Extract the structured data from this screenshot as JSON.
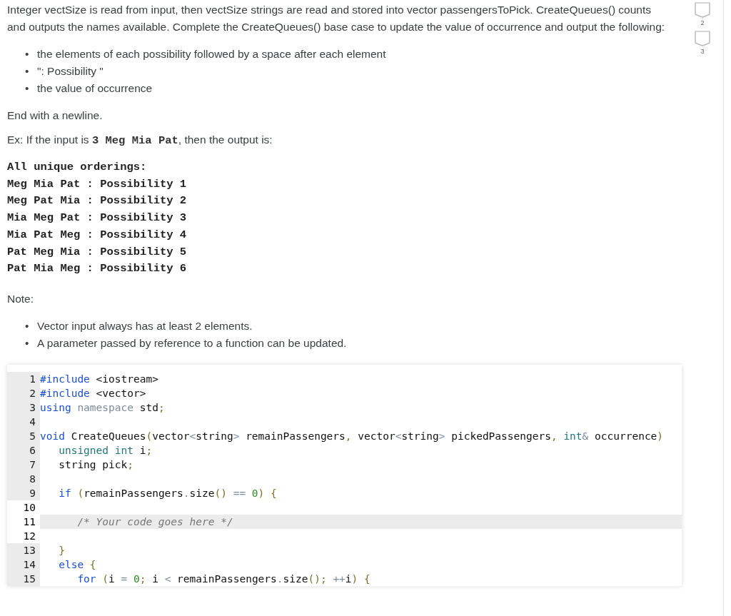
{
  "intro": "Integer vectSize is read from input, then vectSize strings are read and stored into vector passengersToPick. CreateQueues() counts and outputs the names available. Complete the CreateQueues() base case to update the value of occurrence and output the following:",
  "bullets": [
    {
      "marker": "•",
      "text": "the elements of each possibility followed by a space after each element"
    },
    {
      "marker": "•",
      "text": "\": Possibility \""
    },
    {
      "marker": "•",
      "text": "the value of occurrence"
    }
  ],
  "ending": "End with a newline.",
  "example": {
    "before": "Ex: If the input is ",
    "code": "3 Meg Mia Pat",
    "after": ", then the output is:"
  },
  "output_lines": [
    "All unique orderings:",
    "Meg Mia Pat : Possibility 1",
    "Meg Pat Mia : Possibility 2",
    "Mia Meg Pat : Possibility 3",
    "Mia Pat Meg : Possibility 4",
    "Pat Meg Mia : Possibility 5",
    "Pat Mia Meg : Possibility 6"
  ],
  "note_label": "Note:",
  "notes": [
    {
      "marker": "•",
      "text": "Vector input always has at least 2 elements."
    },
    {
      "marker": "•",
      "text": "A parameter passed by reference to a function can be updated."
    }
  ],
  "code_lines": [
    {
      "number": "1",
      "editable": false,
      "active": false,
      "tokens": [
        {
          "kind": "kw",
          "text": "#include"
        },
        {
          "kind": "plain",
          "text": " <iostream>"
        }
      ]
    },
    {
      "number": "2",
      "editable": false,
      "active": false,
      "tokens": [
        {
          "kind": "kw",
          "text": "#include"
        },
        {
          "kind": "plain",
          "text": " <vector>"
        }
      ]
    },
    {
      "number": "3",
      "editable": false,
      "active": false,
      "tokens": [
        {
          "kind": "kw",
          "text": "using"
        },
        {
          "kind": "ns",
          "text": " namespace"
        },
        {
          "kind": "plain",
          "text": " std"
        },
        {
          "kind": "punct",
          "text": ";"
        }
      ]
    },
    {
      "number": "4",
      "editable": false,
      "active": false
    },
    {
      "number": "5",
      "editable": false,
      "active": false,
      "tokens": [
        {
          "kind": "kw",
          "text": "void"
        },
        {
          "kind": "plain",
          "text": " CreateQueues"
        },
        {
          "kind": "punct",
          "text": "("
        },
        {
          "kind": "plain",
          "text": "vector"
        },
        {
          "kind": "ns",
          "text": "<"
        },
        {
          "kind": "plain",
          "text": "string"
        },
        {
          "kind": "ns",
          "text": ">"
        },
        {
          "kind": "plain",
          "text": " remainPassengers"
        },
        {
          "kind": "punct",
          "text": ","
        },
        {
          "kind": "plain",
          "text": " vector"
        },
        {
          "kind": "ns",
          "text": "<"
        },
        {
          "kind": "plain",
          "text": "string"
        },
        {
          "kind": "ns",
          "text": ">"
        },
        {
          "kind": "plain",
          "text": " pickedPassengers"
        },
        {
          "kind": "punct",
          "text": ","
        },
        {
          "kind": "type",
          "text": " int"
        },
        {
          "kind": "ns",
          "text": "&"
        },
        {
          "kind": "plain",
          "text": " occurrence"
        },
        {
          "kind": "punct",
          "text": ")"
        }
      ]
    },
    {
      "number": "6",
      "editable": false,
      "active": false,
      "tokens": [
        {
          "kind": "type",
          "text": "   unsigned int"
        },
        {
          "kind": "plain",
          "text": " i"
        },
        {
          "kind": "punct",
          "text": ";"
        }
      ]
    },
    {
      "number": "7",
      "editable": false,
      "active": false,
      "tokens": [
        {
          "kind": "plain",
          "text": "   string pick"
        },
        {
          "kind": "punct",
          "text": ";"
        }
      ]
    },
    {
      "number": "8",
      "editable": false,
      "active": false
    },
    {
      "number": "9",
      "editable": false,
      "active": false,
      "tokens": [
        {
          "kind": "kw",
          "text": "   if"
        },
        {
          "kind": "punct",
          "text": " ("
        },
        {
          "kind": "plain",
          "text": "remainPassengers"
        },
        {
          "kind": "ns",
          "text": "."
        },
        {
          "kind": "plain",
          "text": "size"
        },
        {
          "kind": "punct",
          "text": "()"
        },
        {
          "kind": "ns",
          "text": " =="
        },
        {
          "kind": "num",
          "text": " 0"
        },
        {
          "kind": "punct",
          "text": ") {"
        }
      ]
    },
    {
      "number": "10",
      "editable": true,
      "active": false
    },
    {
      "number": "11",
      "editable": true,
      "active": true,
      "tokens": [
        {
          "kind": "comment",
          "text": "      /* Your code goes here */"
        }
      ]
    },
    {
      "number": "12",
      "editable": true,
      "active": false
    },
    {
      "number": "13",
      "editable": false,
      "active": false,
      "tokens": [
        {
          "kind": "punct",
          "text": "   }"
        }
      ]
    },
    {
      "number": "14",
      "editable": false,
      "active": false,
      "tokens": [
        {
          "kind": "kw",
          "text": "   else"
        },
        {
          "kind": "punct",
          "text": " {"
        }
      ]
    },
    {
      "number": "15",
      "editable": false,
      "active": false,
      "tokens": [
        {
          "kind": "kw",
          "text": "      for"
        },
        {
          "kind": "punct",
          "text": " ("
        },
        {
          "kind": "plain",
          "text": "i"
        },
        {
          "kind": "ns",
          "text": " ="
        },
        {
          "kind": "num",
          "text": " 0"
        },
        {
          "kind": "punct",
          "text": ";"
        },
        {
          "kind": "plain",
          "text": " i"
        },
        {
          "kind": "ns",
          "text": " <"
        },
        {
          "kind": "plain",
          "text": " remainPassengers"
        },
        {
          "kind": "ns",
          "text": "."
        },
        {
          "kind": "plain",
          "text": "size"
        },
        {
          "kind": "punct",
          "text": "();"
        },
        {
          "kind": "ns",
          "text": " ++"
        },
        {
          "kind": "plain",
          "text": "i"
        },
        {
          "kind": "punct",
          "text": ") {"
        }
      ]
    }
  ],
  "side_markers": [
    "2",
    "3"
  ]
}
